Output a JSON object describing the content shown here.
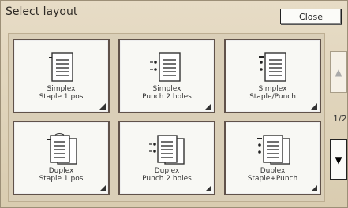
{
  "window": {
    "title": "Select layout",
    "close_label": "Close"
  },
  "layouts": [
    {
      "line1": "Simplex",
      "line2": "Staple 1 pos",
      "icon": "simplex-staple-icon"
    },
    {
      "line1": "Simplex",
      "line2": "Punch 2 holes",
      "icon": "simplex-punch-icon"
    },
    {
      "line1": "Simplex",
      "line2": "Staple/Punch",
      "icon": "simplex-staple-punch-icon"
    },
    {
      "line1": "Duplex",
      "line2": "Staple 1 pos",
      "icon": "duplex-staple-icon"
    },
    {
      "line1": "Duplex",
      "line2": "Punch 2 holes",
      "icon": "duplex-punch-icon"
    },
    {
      "line1": "Duplex",
      "line2": "Staple+Punch",
      "icon": "duplex-staple-punch-icon"
    }
  ],
  "pagination": {
    "indicator": "1/2"
  }
}
